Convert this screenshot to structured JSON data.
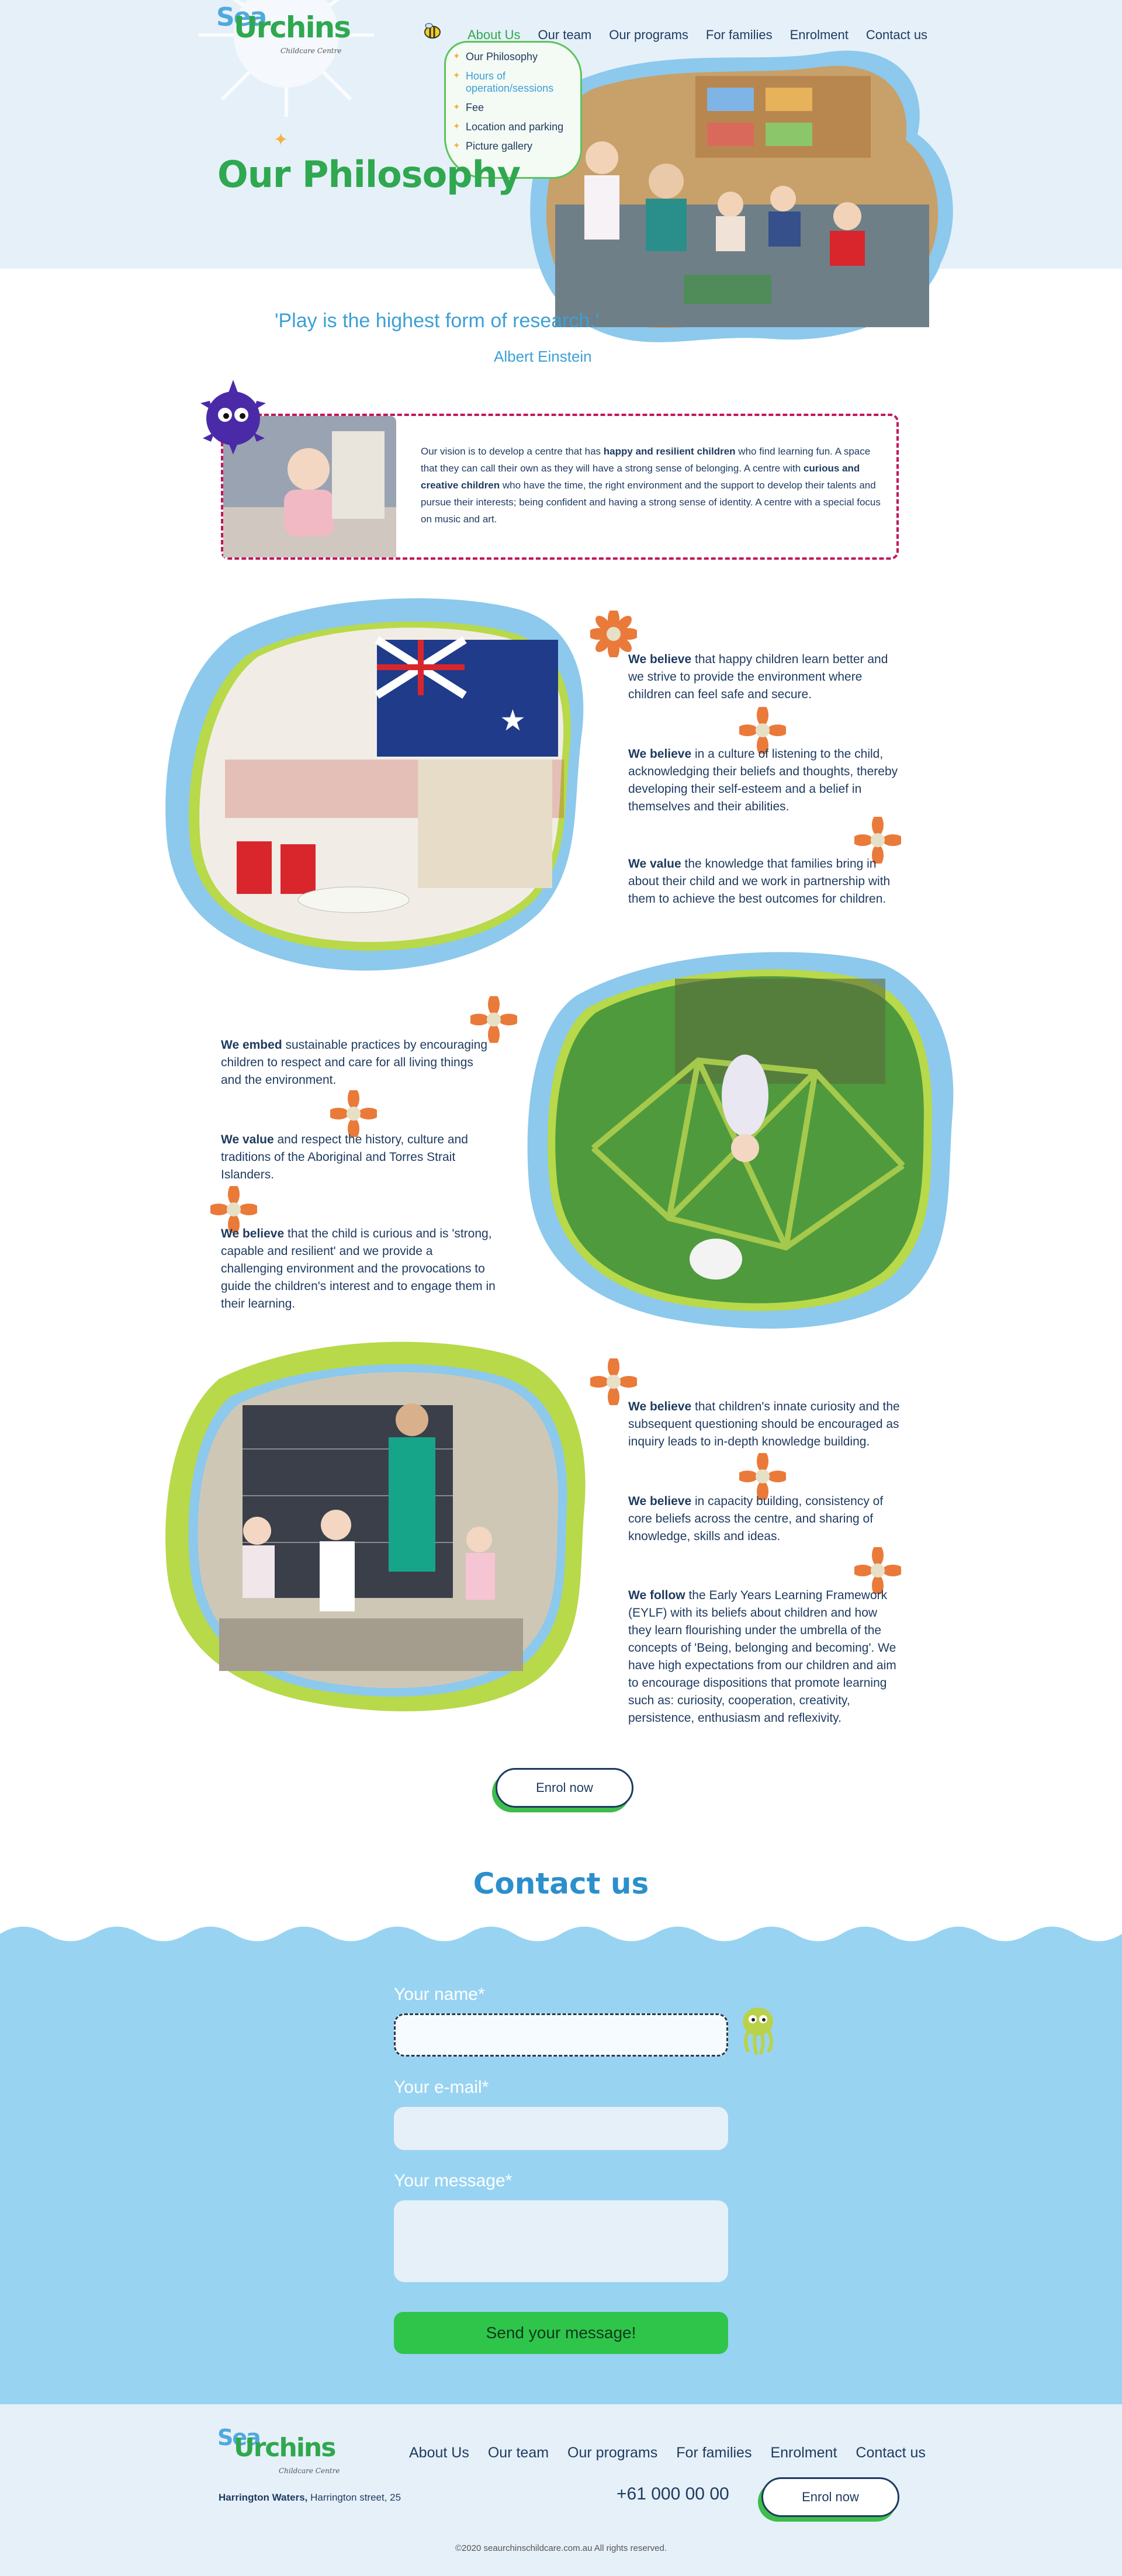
{
  "brand": {
    "logo_sea": "Sea",
    "logo_urchins": "Urchins",
    "logo_sub": "Childcare Centre"
  },
  "nav": {
    "items": [
      "About Us",
      "Our team",
      "Our programs",
      "For families",
      "Enrolment",
      "Contact us"
    ],
    "active": "About Us"
  },
  "dropdown": {
    "items": [
      "Our Philosophy",
      "Hours of operation/sessions",
      "Fee",
      "Location and parking",
      "Picture gallery"
    ]
  },
  "page_title": "Our Philosophy",
  "quote": {
    "text": "'Play is the highest form of research.'",
    "author": "Albert Einstein"
  },
  "vision": {
    "parts": [
      "Our vision is to develop a centre that has ",
      "happy and resilient children",
      " who find learning fun. A space that they can call their own as they will have a strong sense of belonging. A centre with ",
      "curious and creative children",
      " who have the time, the right environment and the support to develop their talents and pursue their interests; being confident and having a strong sense of identity. A centre with a special focus on music and art."
    ]
  },
  "beliefs_1": [
    {
      "lead": "We believe",
      "text": " that happy children learn better and we strive to provide the environment where children can feel safe and secure."
    },
    {
      "lead": "We believe",
      "text": " in a culture of listening to the child, acknowledging their beliefs and thoughts, thereby developing their self-esteem and a belief in themselves and their abilities."
    },
    {
      "lead": "We value",
      "text": " the knowledge that families bring in about their child and we work in partnership with them to achieve the best outcomes for children."
    }
  ],
  "beliefs_2": [
    {
      "lead": "We embed",
      "text": " sustainable practices by encouraging children to respect and care for all living things and the environment."
    },
    {
      "lead": "We value",
      "text": " and respect the history, culture and traditions of the Aboriginal and Torres Strait Islanders."
    },
    {
      "lead": "We believe",
      "text": " that the child is curious and is 'strong, capable and resilient' and we provide a challenging environment and the provocations to guide the children's interest and to engage them in their learning."
    }
  ],
  "beliefs_3": [
    {
      "lead": "We believe",
      "text": " that children's innate curiosity and the subsequent questioning should be encouraged as inquiry leads to in-depth knowledge building."
    },
    {
      "lead": "We believe",
      "text": " in capacity building, consistency of core beliefs across the centre, and sharing of knowledge, skills and ideas."
    },
    {
      "lead": "We follow",
      "text": " the Early Years Learning Framework (EYLF) with its beliefs about children and how they learn flourishing under the umbrella of the concepts of 'Being, belonging and becoming'. We have high expectations from our children and aim to encourage dispositions that promote learning such as: curiosity, cooperation, creativity, persistence, enthusiasm and reflexivity."
    }
  ],
  "enrol_label": "Enrol now",
  "contact": {
    "title": "Contact us",
    "name_label": "Your name*",
    "email_label": "Your e-mail*",
    "message_label": "Your message*",
    "send_label": "Send your message!"
  },
  "footer": {
    "nav": [
      "About Us",
      "Our team",
      "Our programs",
      "For families",
      "Enrolment",
      "Contact us"
    ],
    "address_bold": "Harrington Waters,",
    "address_rest": " Harrington street, 25",
    "phone": "+61 000 00 00",
    "enrol_label": "Enrol now",
    "copyright": "©2020 seaurchinschildcare.com.au All rights reserved."
  },
  "colors": {
    "green": "#2fa84f",
    "blue": "#3ca0d6",
    "sky": "#99d3f2",
    "navy": "#1e3a5f",
    "magenta": "#c0185a",
    "orange": "#ea7a3a"
  }
}
